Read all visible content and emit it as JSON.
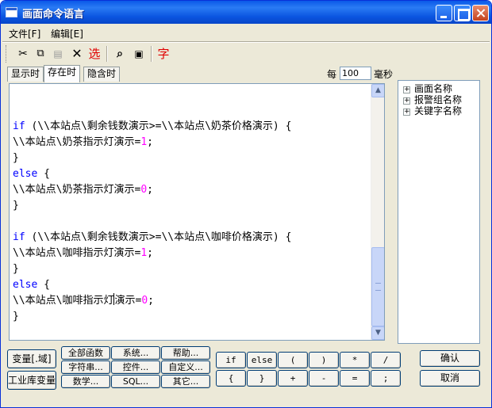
{
  "window": {
    "title": "画面命令语言"
  },
  "menu": {
    "file": "文件[F]",
    "edit": "编辑[E]"
  },
  "toolbar": {
    "items": [
      {
        "name": "cut-icon",
        "glyph": "✂"
      },
      {
        "name": "copy-icon",
        "glyph": "⧉"
      },
      {
        "name": "paste-icon",
        "glyph": "📋"
      },
      {
        "name": "delete-icon",
        "glyph": "✕"
      },
      {
        "name": "select-icon",
        "glyph": "选"
      },
      {
        "name": "find-icon",
        "glyph": "🔍"
      },
      {
        "name": "replace-icon",
        "glyph": "⚭"
      },
      {
        "name": "font-icon",
        "glyph": "字"
      }
    ]
  },
  "tabs": [
    {
      "label": "显示时",
      "active": false
    },
    {
      "label": "存在时",
      "active": true
    },
    {
      "label": "隐含时",
      "active": false
    }
  ],
  "interval": {
    "label": "每",
    "value": "100",
    "unit": "毫秒"
  },
  "code": [
    [],
    [
      {
        "t": "kw",
        "v": "if"
      },
      {
        "t": "txt",
        "v": " (\\\\本站点\\剩余钱数演示>=\\\\本站点\\奶茶价格演示) {"
      }
    ],
    [
      {
        "t": "txt",
        "v": "\\\\本站点\\奶茶指示灯演示="
      },
      {
        "t": "num",
        "v": "1"
      },
      {
        "t": "txt",
        "v": ";"
      }
    ],
    [
      {
        "t": "txt",
        "v": "}"
      }
    ],
    [
      {
        "t": "kw",
        "v": "else"
      },
      {
        "t": "txt",
        "v": " {"
      }
    ],
    [
      {
        "t": "txt",
        "v": "\\\\本站点\\奶茶指示灯演示="
      },
      {
        "t": "num",
        "v": "0"
      },
      {
        "t": "txt",
        "v": ";"
      }
    ],
    [
      {
        "t": "txt",
        "v": "}"
      }
    ],
    [],
    [
      {
        "t": "kw",
        "v": "if"
      },
      {
        "t": "txt",
        "v": " (\\\\本站点\\剩余钱数演示>=\\\\本站点\\咖啡价格演示) {"
      }
    ],
    [
      {
        "t": "txt",
        "v": "\\\\本站点\\咖啡指示灯演示="
      },
      {
        "t": "num",
        "v": "1"
      },
      {
        "t": "txt",
        "v": ";"
      }
    ],
    [
      {
        "t": "txt",
        "v": "}"
      }
    ],
    [
      {
        "t": "kw",
        "v": "else"
      },
      {
        "t": "txt",
        "v": " {"
      }
    ],
    [
      {
        "t": "txt",
        "v": "\\\\本站点\\咖啡指示灯"
      },
      {
        "t": "caret",
        "v": ""
      },
      {
        "t": "txt",
        "v": "演示="
      },
      {
        "t": "num",
        "v": "0"
      },
      {
        "t": "txt",
        "v": ";"
      }
    ],
    [
      {
        "t": "txt",
        "v": "}"
      }
    ]
  ],
  "tree": [
    "画面名称",
    "报警组名称",
    "关键字名称"
  ],
  "buttons": {
    "variable": "变量[.域]",
    "db_variable": "工业库变量",
    "all_functions": "全部函数",
    "string": "字符串...",
    "math": "数学...",
    "system": "系统...",
    "control": "控件...",
    "sql": "SQL...",
    "help": "帮助...",
    "custom": "自定义...",
    "other": "其它...",
    "confirm": "确认",
    "cancel": "取消"
  },
  "operators": [
    "if",
    "else",
    "(",
    ")",
    "*",
    "/",
    "{",
    "}",
    "+",
    "-",
    "=",
    ";"
  ],
  "colors": {
    "keyword": "#0000ff",
    "number": "#ff00ff",
    "title_bar": "#0a58e8"
  }
}
